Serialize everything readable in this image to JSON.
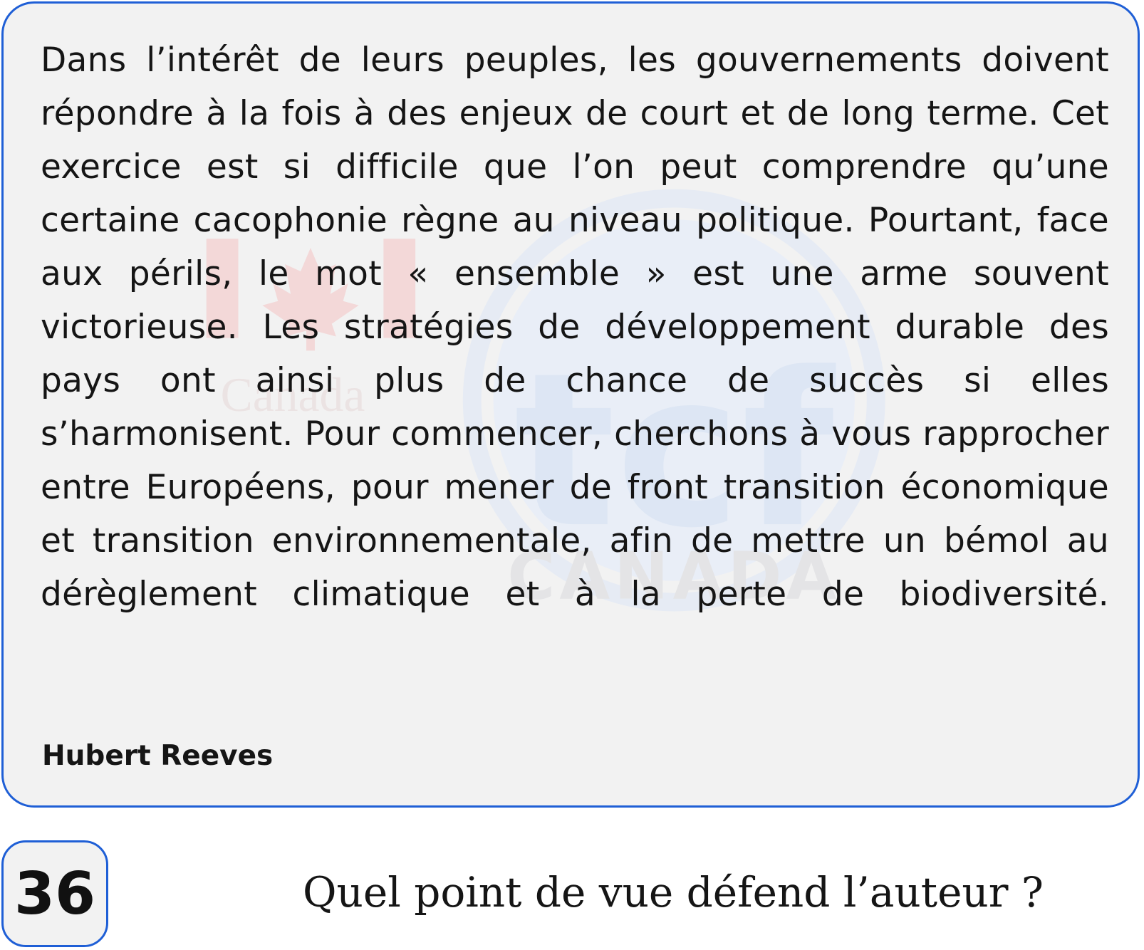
{
  "passage": {
    "text": "Dans l’intérêt de leurs peuples, les gouvernements doivent répondre à la fois à des enjeux de court et de long terme. Cet exercice est si difficile que l’on peut comprendre qu’une certaine cacophonie règne au niveau politique. Pourtant, face aux périls, le mot « ensemble » est une arme souvent victorieuse. Les stratégies de développement durable des pays ont ainsi plus de chance de succès si elles s’harmonisent. Pour commencer, cherchons à vous rapprocher entre Européens, pour mener de front transition économique et transition environnementale, afin de mettre un bémol au dérèglement climatique et à la perte de biodiversité.",
    "author": "Hubert Reeves"
  },
  "watermark": {
    "brand_text": "Canada",
    "logo_text": "tcf",
    "country_text": "CANADA"
  },
  "question": {
    "number": "36",
    "text": "Quel point de vue défend l’auteur ?"
  },
  "colors": {
    "border": "#1f5fd6",
    "card_background": "#f2f2f2",
    "text": "#151515",
    "watermark_red": "#f3d8d8",
    "watermark_blue": "#dde6f4"
  }
}
